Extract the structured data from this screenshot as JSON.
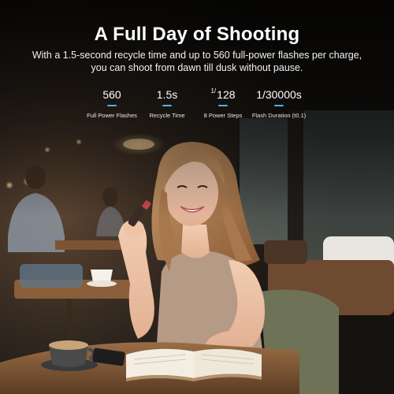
{
  "headline": "A Full Day of Shooting",
  "subline_line1": "With a 1.5-second recycle time and up to 560 full-power flashes per charge,",
  "subline_line2": "you can shoot from dawn till dusk without pause.",
  "stats": [
    {
      "value": "560",
      "label": "Full Power Flashes"
    },
    {
      "value": "1.5s",
      "label": "Recycle Time"
    },
    {
      "value": "128",
      "prefix": "1/",
      "label": "8 Power Steps"
    },
    {
      "value": "1/30000s",
      "label": "Flash Duration (t0.1)"
    }
  ],
  "colors": {
    "accent": "#4fb3ea",
    "text": "#ffffff",
    "background": "#1b1815"
  }
}
